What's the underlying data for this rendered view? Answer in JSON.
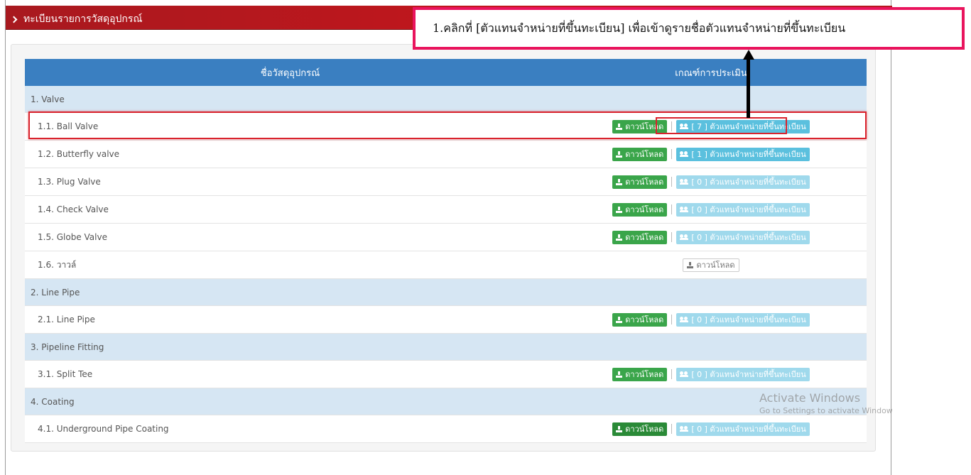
{
  "header": {
    "title": "ทะเบียนรายการวัสดุอุปกรณ์"
  },
  "table": {
    "col_name": "ชื่อวัสดุอุปกรณ์",
    "col_eval": "เกณฑ์การประเมิน",
    "download_label": "ดาวน์โหลด",
    "dealer_suffix": "ตัวแทนจำหน่ายที่ขึ้นทะเบียน",
    "rows": [
      {
        "type": "cat",
        "name": "1. Valve"
      },
      {
        "type": "item",
        "name": "1.1. Ball Valve",
        "dealer": "[ 7 ] ตัวแทนจำหน่ายที่ขึ้นทะเบียน"
      },
      {
        "type": "item",
        "name": "1.2. Butterfly valve",
        "dealer": "[ 1 ] ตัวแทนจำหน่ายที่ขึ้นทะเบียน"
      },
      {
        "type": "item",
        "name": "1.3. Plug Valve",
        "dealer": "[ 0 ] ตัวแทนจำหน่ายที่ขึ้นทะเบียน"
      },
      {
        "type": "item",
        "name": "1.4. Check Valve",
        "dealer": "[ 0 ] ตัวแทนจำหน่ายที่ขึ้นทะเบียน"
      },
      {
        "type": "item",
        "name": "1.5. Globe Valve",
        "dealer": "[ 0 ] ตัวแทนจำหน่ายที่ขึ้นทะเบียน"
      },
      {
        "type": "item",
        "name": "1.6. วาวล์"
      },
      {
        "type": "cat",
        "name": "2. Line Pipe"
      },
      {
        "type": "item",
        "name": "2.1. Line Pipe",
        "dealer": "[ 0 ] ตัวแทนจำหน่ายที่ขึ้นทะเบียน"
      },
      {
        "type": "cat",
        "name": "3. Pipeline Fitting"
      },
      {
        "type": "item",
        "name": "3.1. Split Tee",
        "dealer": "[ 0 ] ตัวแทนจำหน่ายที่ขึ้นทะเบียน"
      },
      {
        "type": "cat",
        "name": "4. Coating"
      },
      {
        "type": "item",
        "name": "4.1. Underground Pipe Coating",
        "dealer": "[ 0 ] ตัวแทนจำหน่ายที่ขึ้นทะเบียน"
      }
    ]
  },
  "callout": {
    "text": "1.คลิกที่ [ตัวแทนจำหน่ายที่ขึ้นทะเบียน] เพื่อเข้าดูรายชื่อตัวแทนจำหน่ายที่ขึ้นทะเบียน"
  },
  "watermark": {
    "title": "Activate Windows",
    "subtitle": "Go to Settings to activate Windows."
  },
  "colors": {
    "header": "#c4161c",
    "table_head": "#3a7fc1",
    "download": "#3aa54a",
    "dealer": "#5bc0de",
    "highlight": "#d9232d",
    "callout_border": "#e9145d"
  }
}
